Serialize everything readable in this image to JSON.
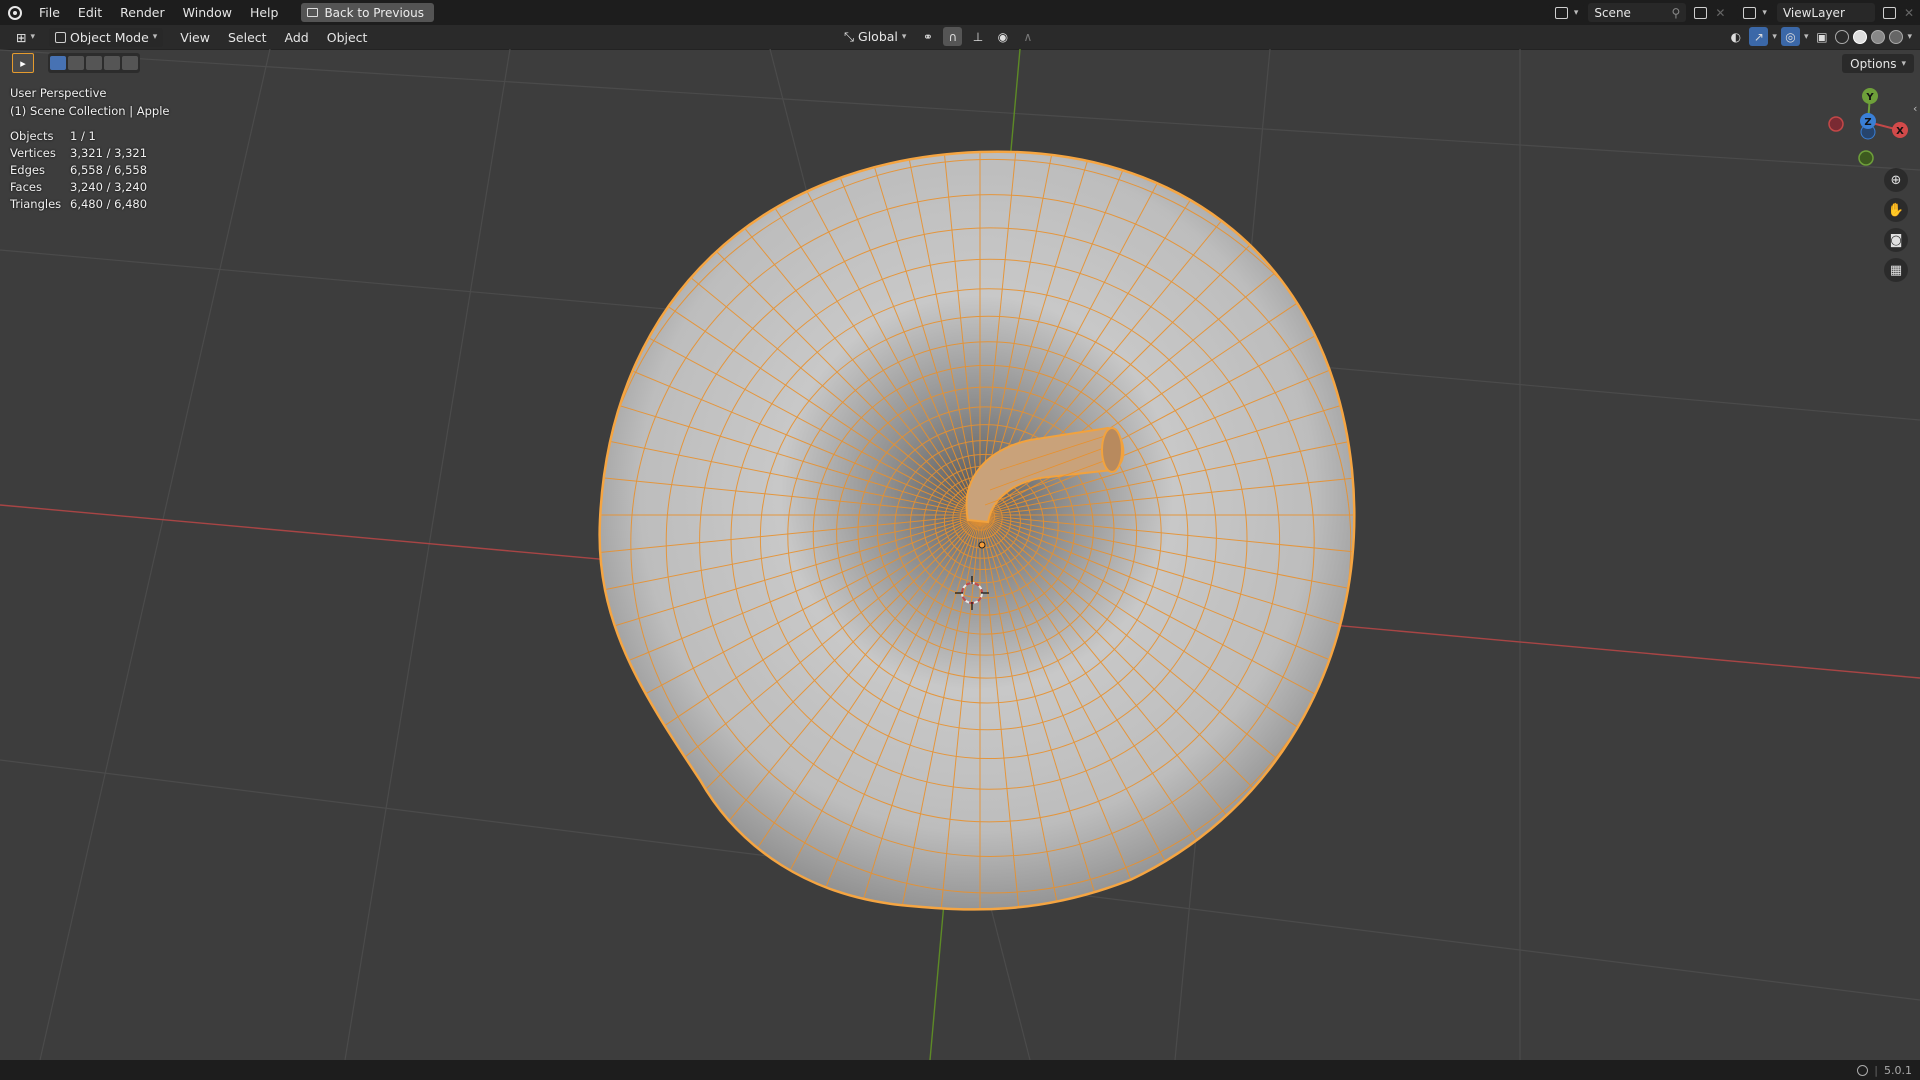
{
  "topbar": {
    "menus": [
      "File",
      "Edit",
      "Render",
      "Window",
      "Help"
    ],
    "back_label": "Back to Previous",
    "scene": "Scene",
    "view_layer": "ViewLayer"
  },
  "header": {
    "mode": "Object Mode",
    "menus": [
      "View",
      "Select",
      "Add",
      "Object"
    ],
    "transform_orientation": "Global",
    "options_label": "Options"
  },
  "overlay": {
    "view_name": "User Perspective",
    "collection": "(1) Scene Collection | Apple",
    "stats": [
      {
        "label": "Objects",
        "value": "1 / 1"
      },
      {
        "label": "Vertices",
        "value": "3,321 / 3,321"
      },
      {
        "label": "Edges",
        "value": "6,558 / 6,558"
      },
      {
        "label": "Faces",
        "value": "3,240 / 3,240"
      },
      {
        "label": "Triangles",
        "value": "6,480 / 6,480"
      }
    ]
  },
  "gizmo": {
    "y": "Y",
    "z": "Z",
    "x": "X"
  },
  "statusbar": {
    "version": "5.0.1"
  },
  "colors": {
    "selection": "#f0a040",
    "x_axis": "#c74a4a",
    "y_axis": "#6c9a2c",
    "z_axis": "#3a7fd5",
    "background": "#3d3d3d"
  },
  "icons": [
    "blender-logo",
    "back-icon",
    "scene-icon",
    "pin-icon",
    "viewlayer-icon",
    "mode-icon",
    "transform-icon",
    "snap-icon",
    "proportional-icon",
    "visibility-icon",
    "gizmo-icon",
    "overlay-icon",
    "xray-icon",
    "shading-icons",
    "zoom-icon",
    "hand-icon",
    "camera-icon",
    "grid-icon",
    "globe-icon"
  ]
}
